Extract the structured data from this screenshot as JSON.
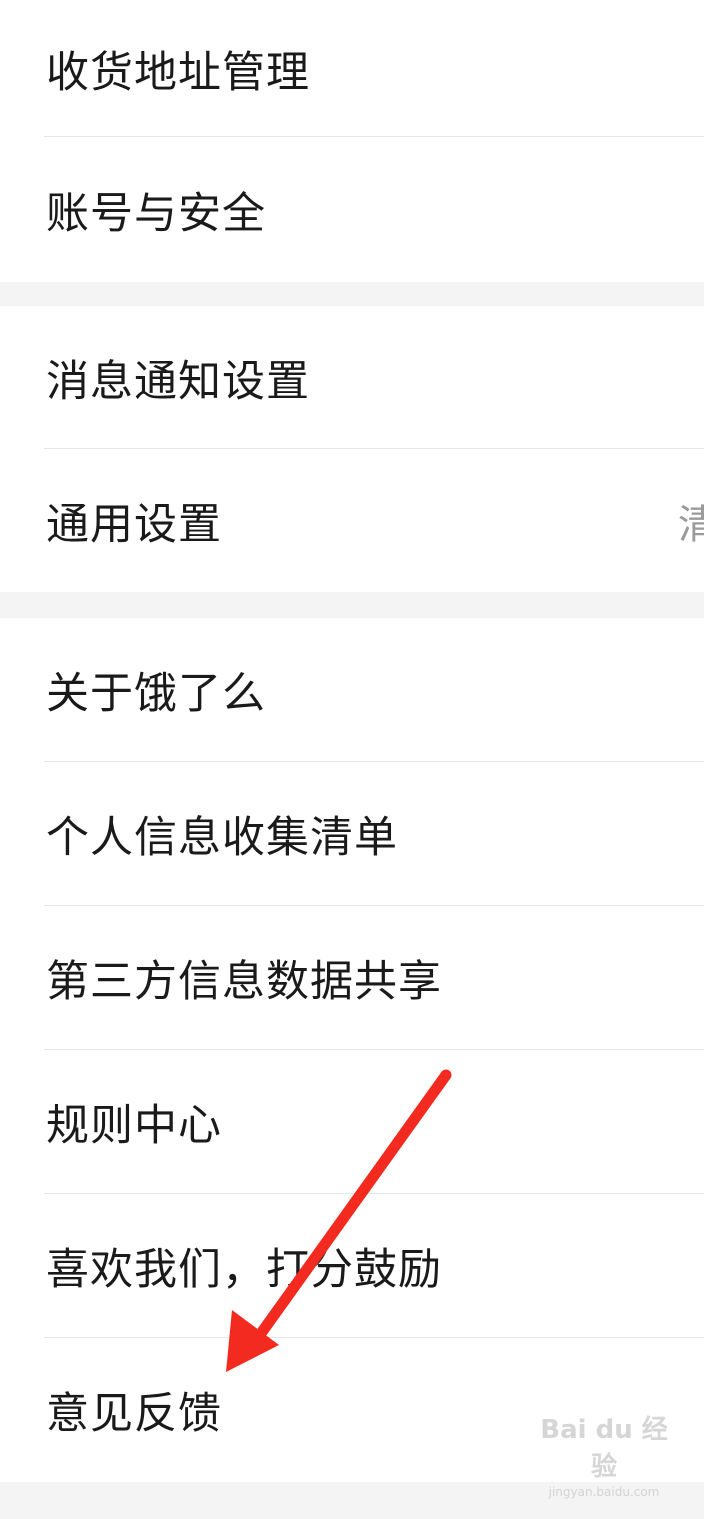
{
  "groups": [
    {
      "items": [
        {
          "label": "收货地址管理"
        },
        {
          "label": "账号与安全"
        }
      ]
    },
    {
      "items": [
        {
          "label": "消息通知设置"
        },
        {
          "label": "通用设置",
          "trailing": "清"
        }
      ]
    },
    {
      "items": [
        {
          "label": "关于饿了么"
        },
        {
          "label": "个人信息收集清单"
        },
        {
          "label": "第三方信息数据共享"
        },
        {
          "label": "规则中心"
        },
        {
          "label": "喜欢我们，打分鼓励"
        },
        {
          "label": "意见反馈"
        }
      ]
    }
  ],
  "watermark": {
    "main": "Bai du 经验",
    "sub": "jingyan.baidu.com"
  },
  "colors": {
    "background": "#f4f4f4",
    "card": "#ffffff",
    "text": "#1a1a1a",
    "divider": "#e6e6e6",
    "annotation_arrow": "#f22a20"
  }
}
